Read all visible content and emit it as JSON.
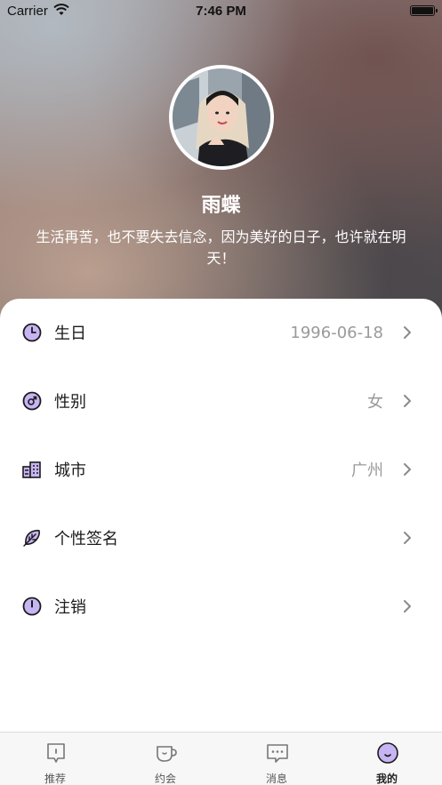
{
  "status_bar": {
    "carrier": "Carrier",
    "time": "7:46 PM"
  },
  "profile": {
    "name": "雨蝶",
    "bio": "生活再苦，也不要失去信念，因为美好的日子，也许就在明天！"
  },
  "settings": [
    {
      "label": "生日",
      "value": "1996-06-18",
      "icon": "clock-icon"
    },
    {
      "label": "性别",
      "value": "女",
      "icon": "gender-icon"
    },
    {
      "label": "城市",
      "value": "广州",
      "icon": "city-buildings-icon"
    },
    {
      "label": "个性签名",
      "value": "",
      "icon": "leaf-icon"
    },
    {
      "label": "注销",
      "value": "",
      "icon": "power-icon"
    }
  ],
  "tabbar": {
    "tabs": [
      {
        "label": "推荐",
        "icon": "card-icon",
        "active": false
      },
      {
        "label": "约会",
        "icon": "cup-icon",
        "active": false
      },
      {
        "label": "消息",
        "icon": "chat-bubble-icon",
        "active": false
      },
      {
        "label": "我的",
        "icon": "smiley-icon",
        "active": true
      }
    ]
  },
  "colors": {
    "accent": "#c7b4f2",
    "icon_stroke": "#1a1a1a"
  }
}
